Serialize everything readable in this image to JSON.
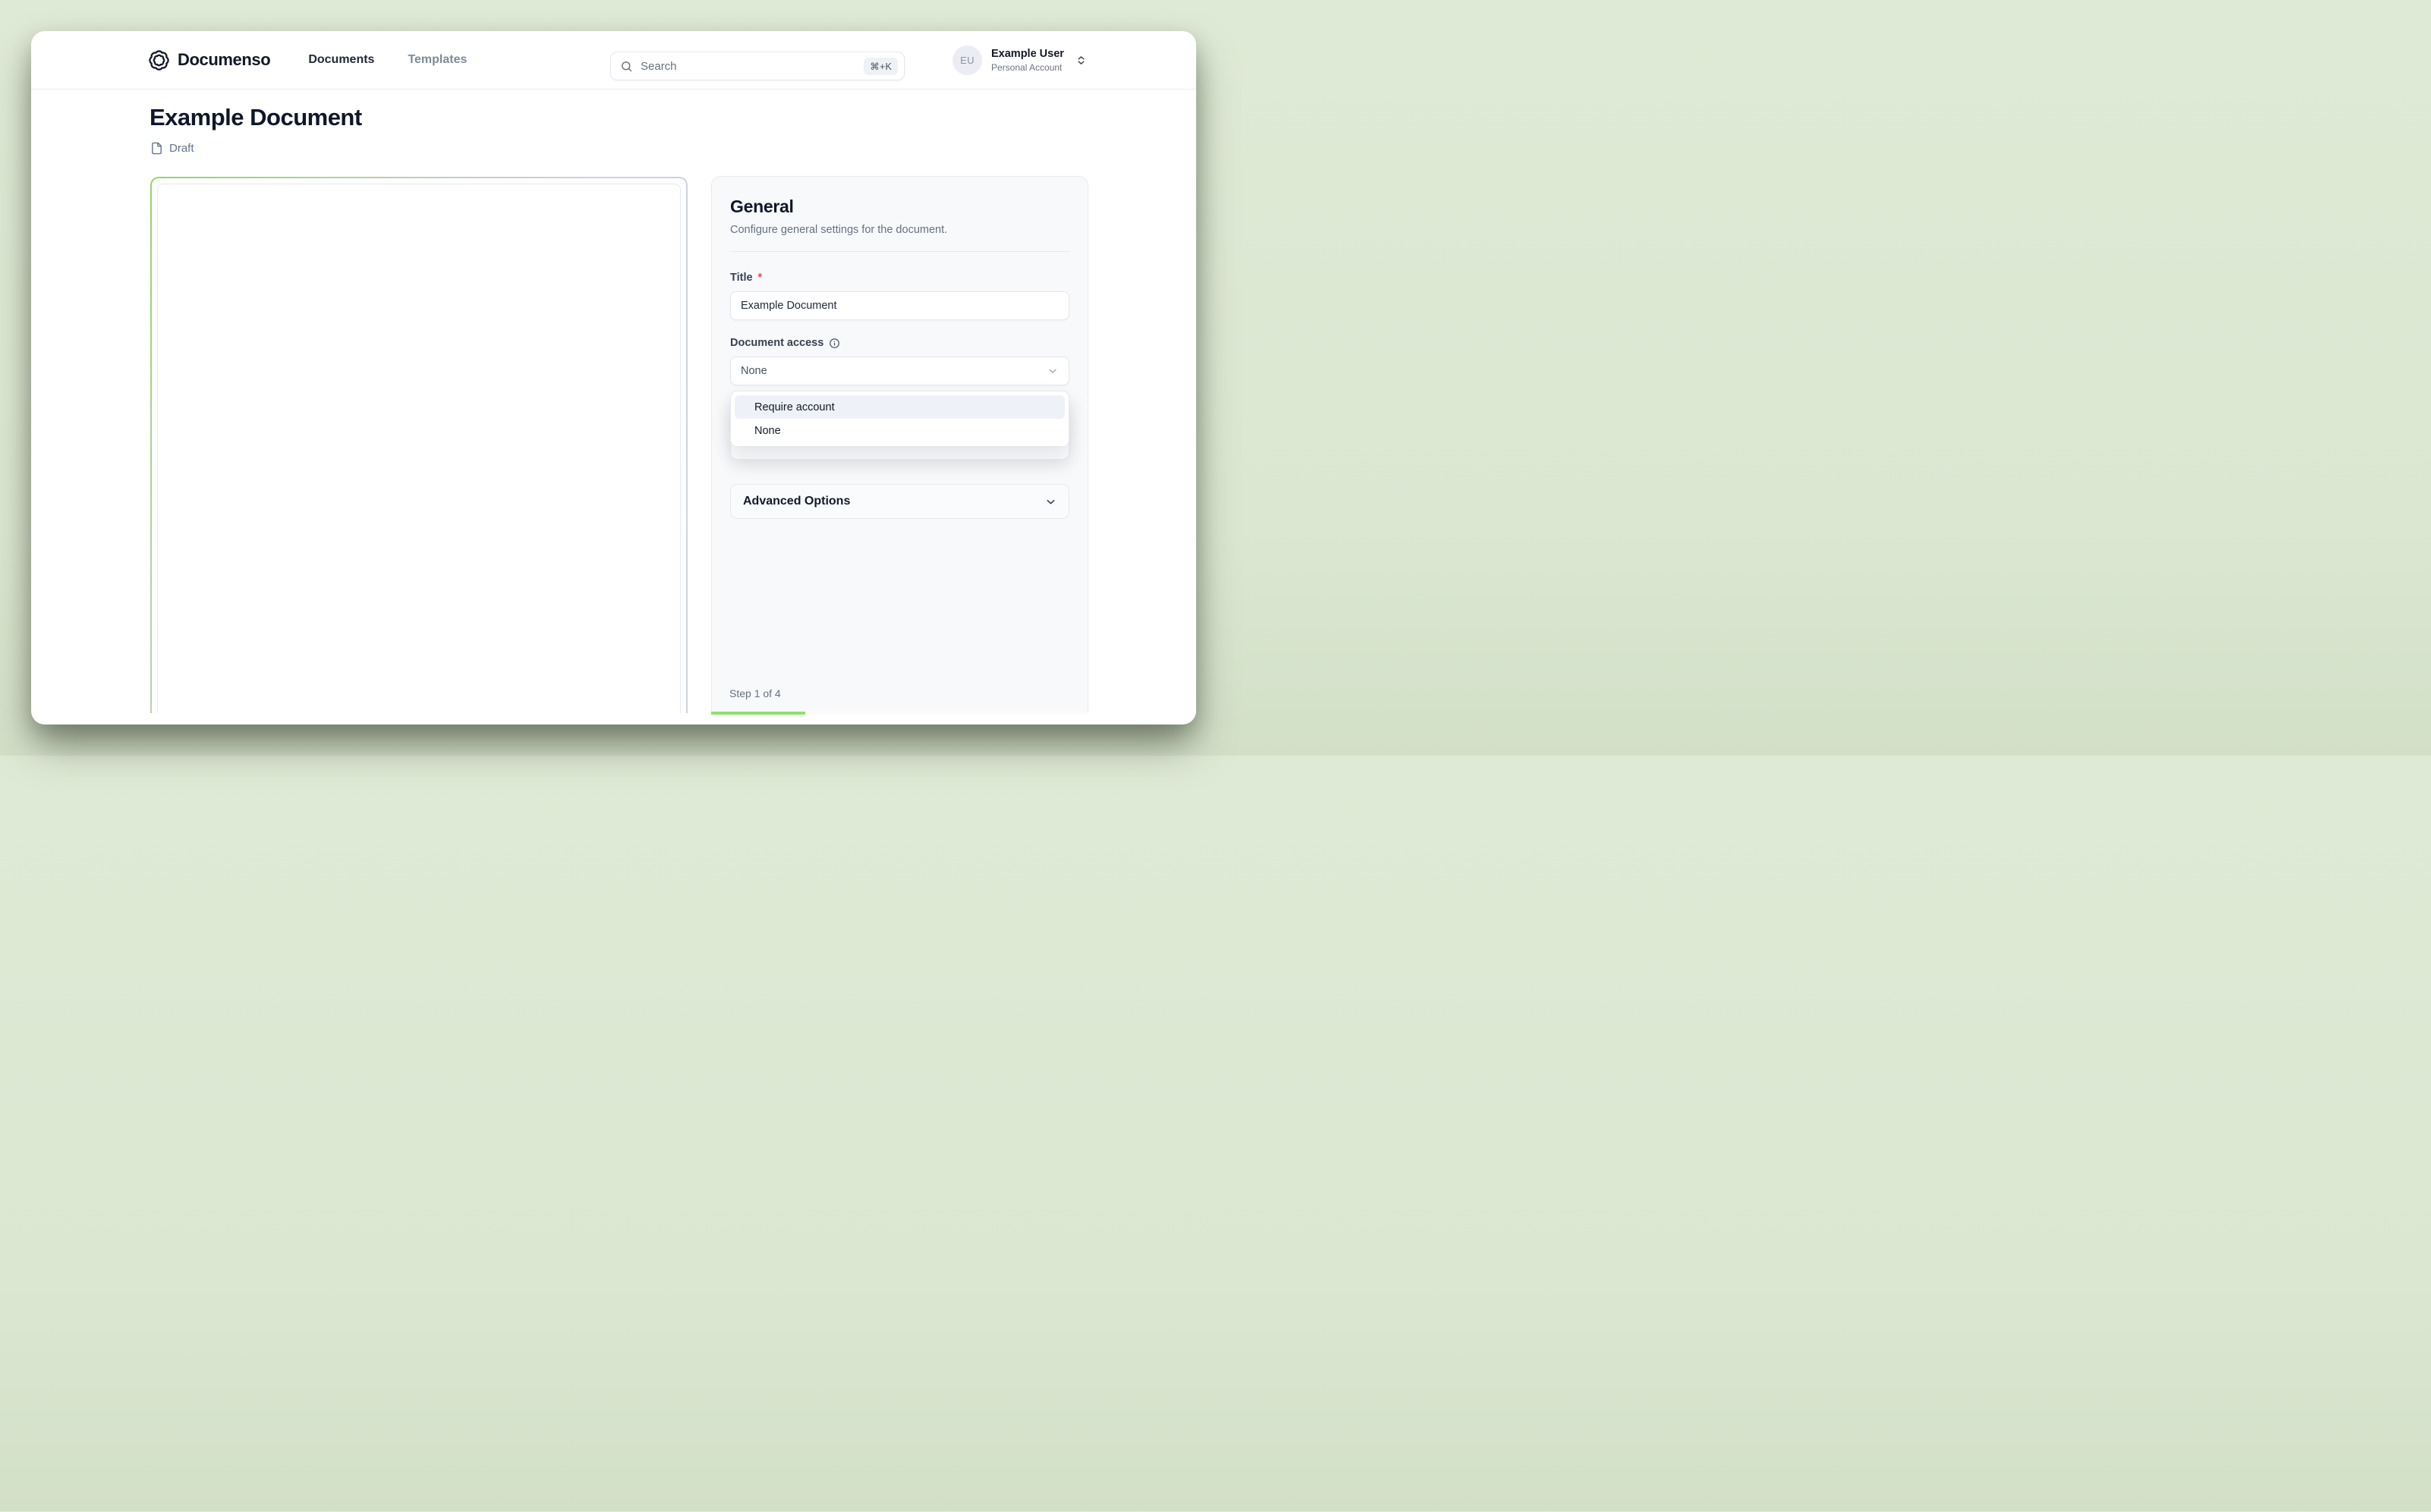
{
  "header": {
    "brand": "Documenso",
    "nav": {
      "documents": "Documents",
      "templates": "Templates"
    },
    "search": {
      "placeholder": "Search",
      "shortcut": "⌘+K"
    },
    "user": {
      "initials": "EU",
      "name": "Example User",
      "account_type": "Personal Account"
    }
  },
  "document": {
    "title": "Example Document",
    "status": "Draft"
  },
  "panel": {
    "title": "General",
    "subtitle": "Configure general settings for the document.",
    "fields": {
      "title": {
        "label": "Title",
        "required_mark": "*",
        "value": "Example Document"
      },
      "access": {
        "label": "Document access",
        "value": "None",
        "options": [
          "Require account",
          "None"
        ],
        "highlighted_option": "Require account"
      }
    },
    "advanced": {
      "label": "Advanced Options"
    },
    "step": {
      "text": "Step 1 of 4",
      "progress_percent": 25
    }
  },
  "colors": {
    "page_background": "#dde9d4",
    "progress_green": "#8ce26d",
    "doc_border_green": "#8fd95f",
    "required_red": "#e5484d",
    "dropdown_highlight": "#eef1f8"
  }
}
